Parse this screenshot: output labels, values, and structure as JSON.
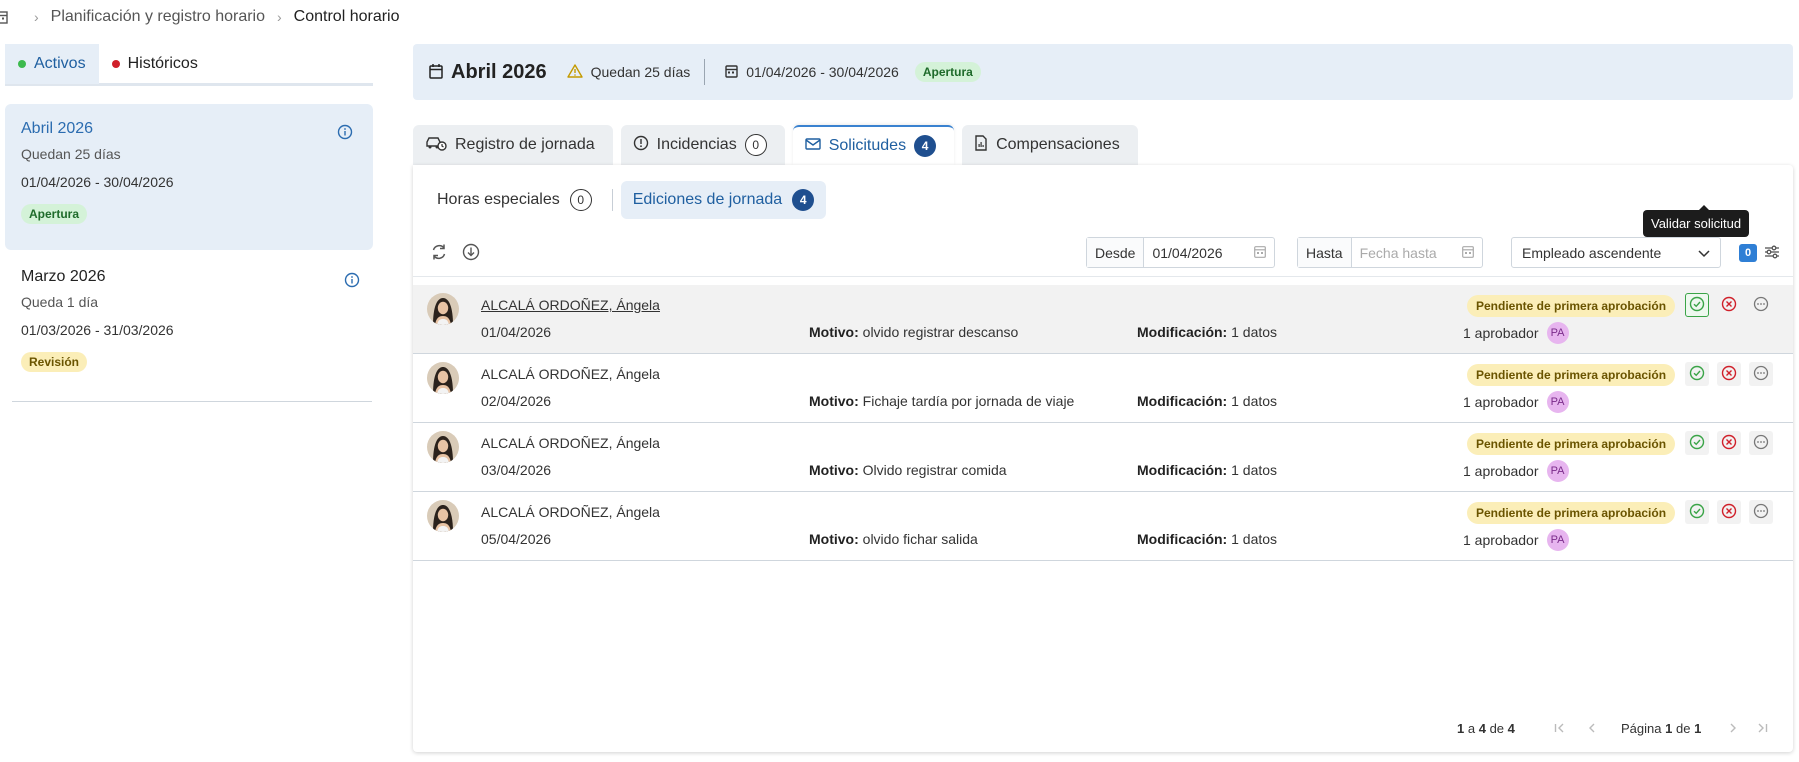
{
  "breadcrumb": {
    "icon": "calendar-icon",
    "link": "Planificación y registro horario",
    "current": "Control horario"
  },
  "left_tabs": [
    {
      "label": "Activos",
      "dot_color": "#3dba4e"
    },
    {
      "label": "Históricos",
      "dot_color": "#d0202a"
    }
  ],
  "periods": [
    {
      "title": "Abril 2026",
      "remaining": "Quedan 25 días",
      "dates": "01/04/2026 - 30/04/2026",
      "status": "Apertura"
    },
    {
      "title": "Marzo 2026",
      "remaining": "Queda 1 día",
      "dates": "01/03/2026 - 31/03/2026",
      "status": "Revisión"
    }
  ],
  "header": {
    "title": "Abril 2026",
    "remaining": "Quedan 25 días",
    "dates": "01/04/2026 - 30/04/2026",
    "status": "Apertura"
  },
  "main_tabs": [
    {
      "label": "Registro de jornada",
      "icon": "car-clock-icon"
    },
    {
      "label": "Incidencias",
      "icon": "alert-circle-icon",
      "count": "0"
    },
    {
      "label": "Solicitudes",
      "icon": "envelope-icon",
      "count": "4"
    },
    {
      "label": "Compensaciones",
      "icon": "document-icon"
    }
  ],
  "sub_tabs": [
    {
      "label": "Horas especiales",
      "count": "0"
    },
    {
      "label": "Ediciones de jornada",
      "count": "4"
    }
  ],
  "filters": {
    "from_label": "Desde",
    "from_value": "01/04/2026",
    "to_label": "Hasta",
    "to_placeholder": "Fecha hasta",
    "sort": "Empleado ascendente",
    "active_filters": "0"
  },
  "labels": {
    "motivo": "Motivo:",
    "modificacion": "Modificación:"
  },
  "rows": [
    {
      "name": "ALCALÁ ORDOÑEZ, Ángela",
      "date": "01/04/2026",
      "motivo": "olvido registrar descanso",
      "mod": "1 datos",
      "status": "Pendiente de primera aprobación",
      "approvers": "1 aprobador",
      "approver_initials": "PA"
    },
    {
      "name": "ALCALÁ ORDOÑEZ, Ángela",
      "date": "02/04/2026",
      "motivo": "Fichaje tardía por jornada de viaje",
      "mod": "1 datos",
      "status": "Pendiente de primera aprobación",
      "approvers": "1 aprobador",
      "approver_initials": "PA"
    },
    {
      "name": "ALCALÁ ORDOÑEZ, Ángela",
      "date": "03/04/2026",
      "motivo": "Olvido registrar comida",
      "mod": "1 datos",
      "status": "Pendiente de primera aprobación",
      "approvers": "1 aprobador",
      "approver_initials": "PA"
    },
    {
      "name": "ALCALÁ ORDOÑEZ, Ángela",
      "date": "05/04/2026",
      "motivo": "olvido fichar salida",
      "mod": "1 datos",
      "status": "Pendiente de primera aprobación",
      "approvers": "1 aprobador",
      "approver_initials": "PA"
    }
  ],
  "tooltip": "Validar solicitud",
  "pagination": {
    "from": "1",
    "sep1": "a",
    "to": "4",
    "sep2": "de",
    "total": "4",
    "page_label": "Página",
    "page": "1",
    "of": "de",
    "pages": "1"
  },
  "colors": {
    "accent": "#1f5fa0",
    "count_badge": "#1f4f8f",
    "approve": "#3aa447",
    "reject": "#d0202a",
    "pending_badge": "#fbeeb8"
  }
}
